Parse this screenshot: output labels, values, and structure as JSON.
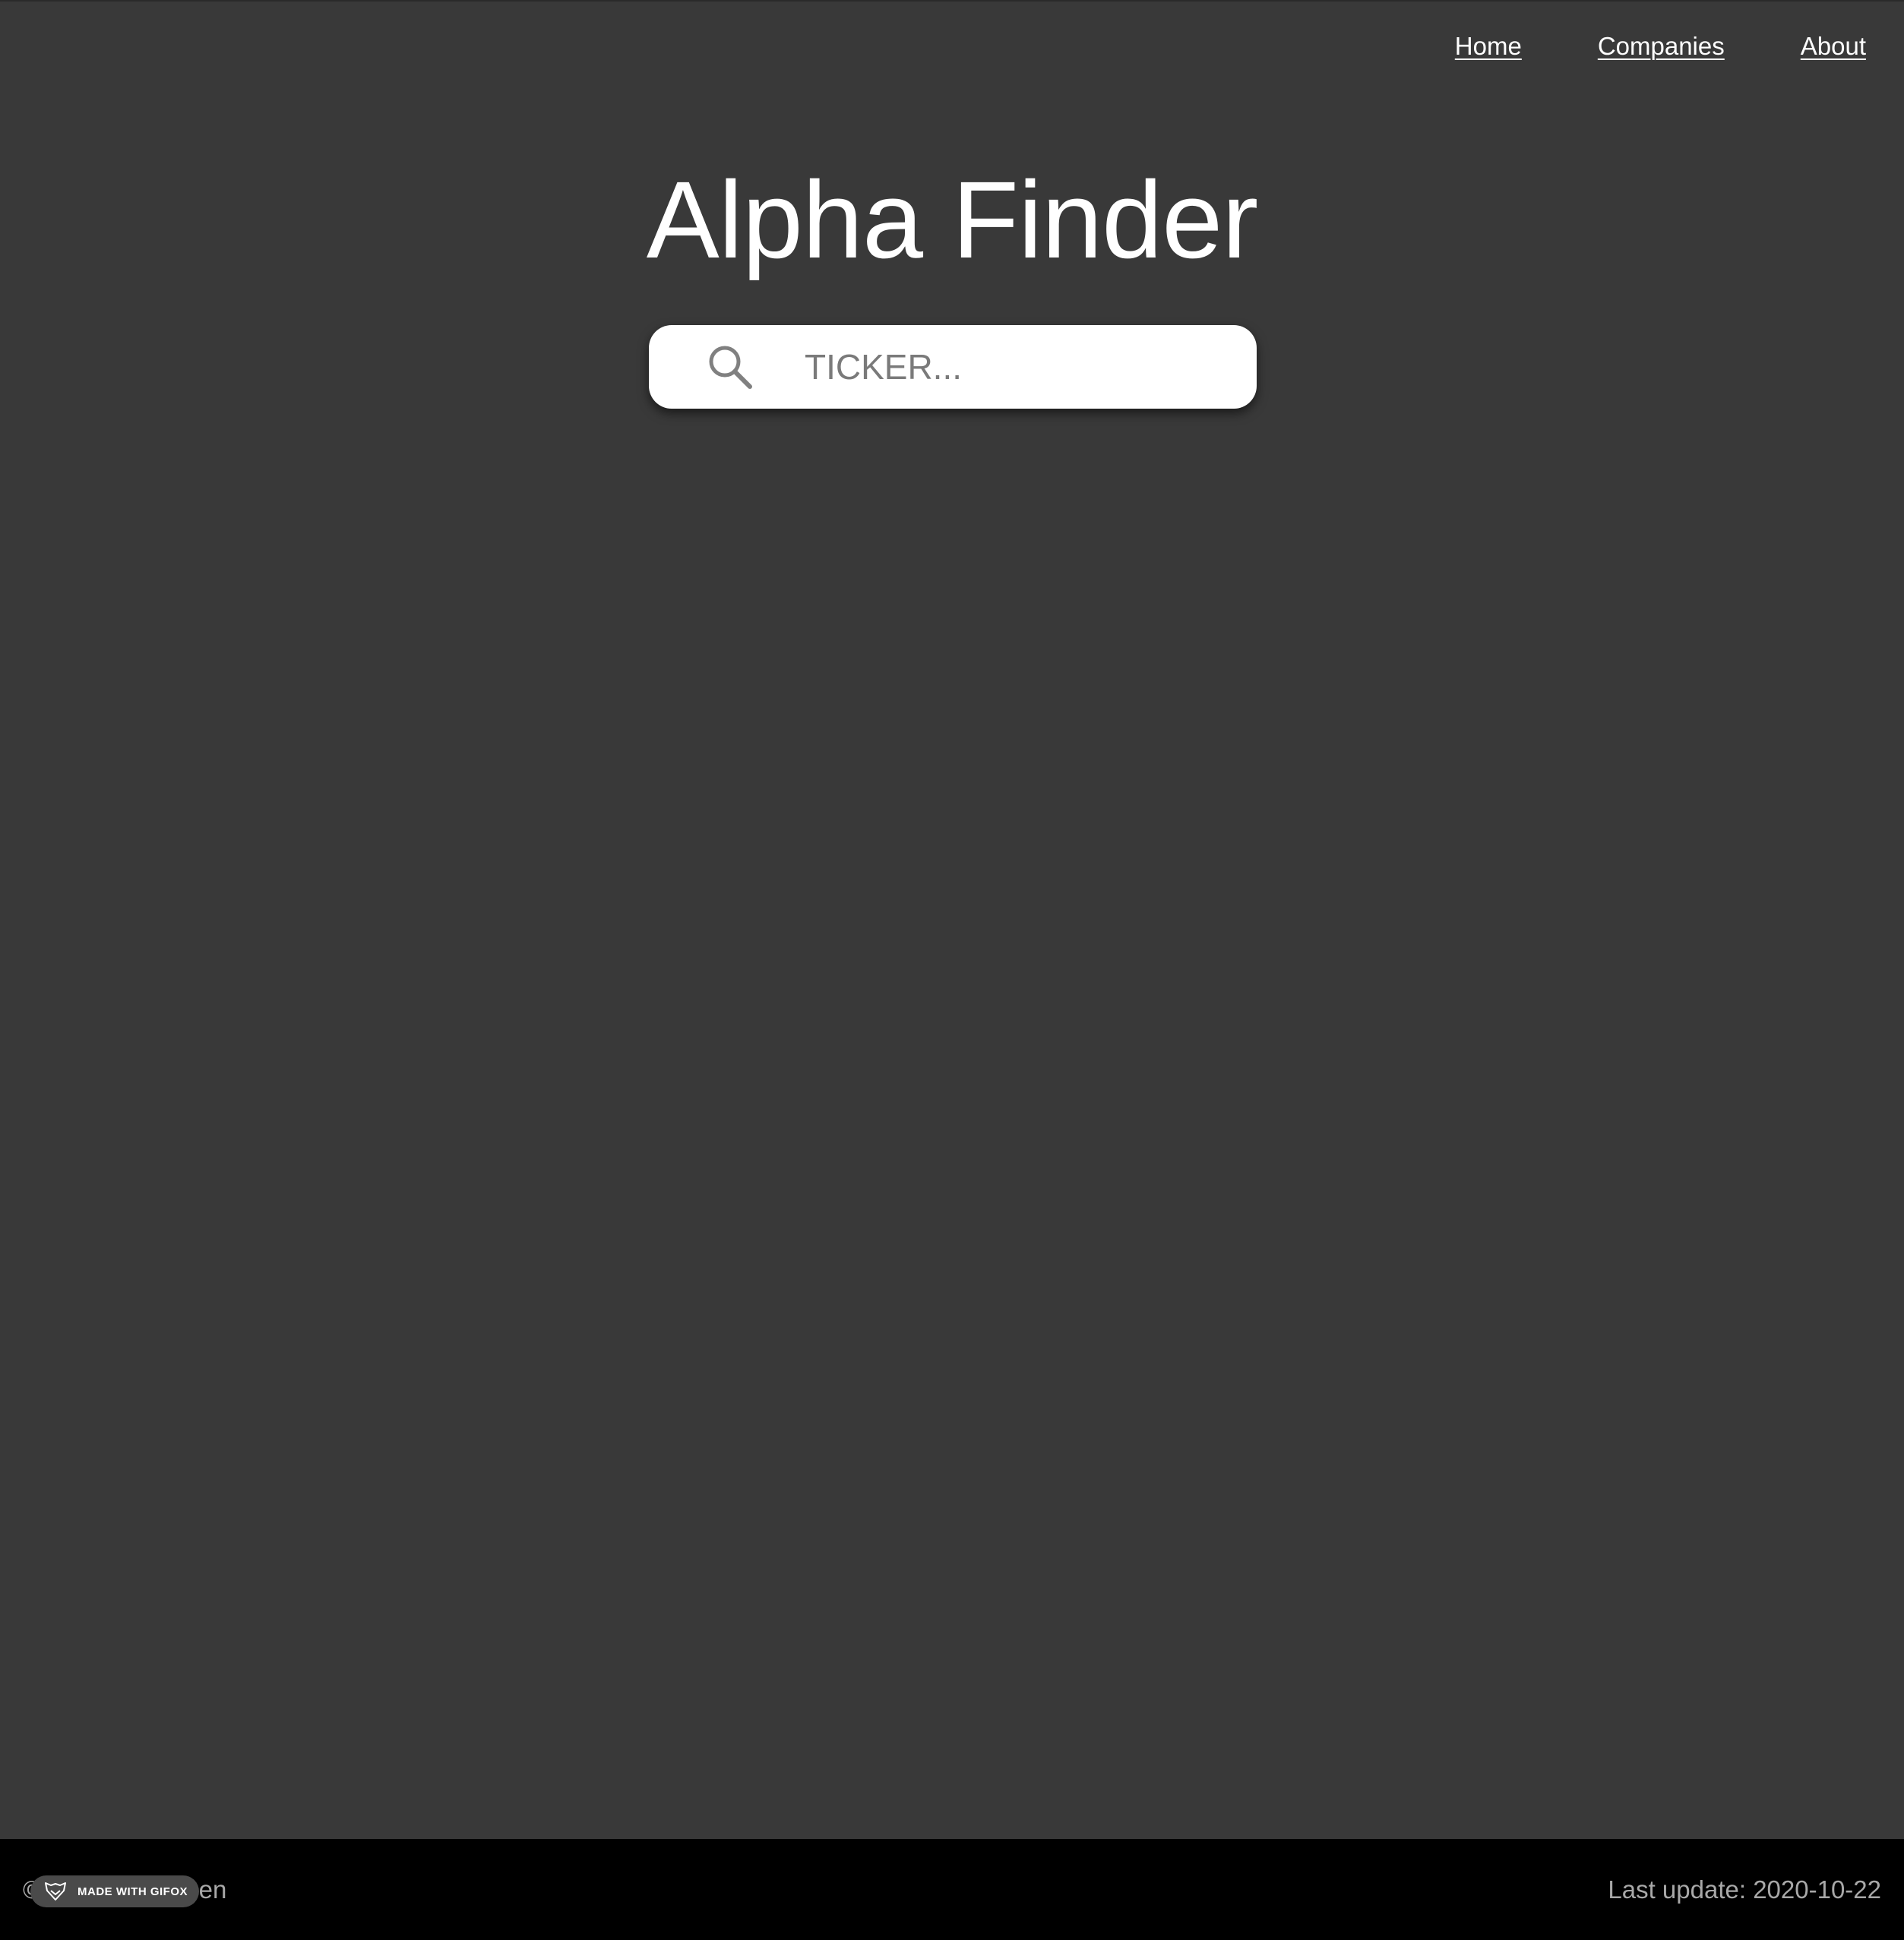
{
  "nav": {
    "items": [
      {
        "label": "Home"
      },
      {
        "label": "Companies"
      },
      {
        "label": "About"
      }
    ]
  },
  "page": {
    "title": "Alpha Finder"
  },
  "search": {
    "placeholder": "TICKER...",
    "value": "",
    "icon": "search-icon"
  },
  "footer": {
    "left_text": "© Andre Andersen",
    "right_text": "Last update: 2020-10-22"
  },
  "watermark": {
    "text": "MADE WITH GIFOX",
    "icon": "gifox-logo-icon"
  },
  "colors": {
    "background": "#393939",
    "footer_background": "#000000",
    "search_background": "#ffffff",
    "footer_text": "#a8a8a8"
  }
}
